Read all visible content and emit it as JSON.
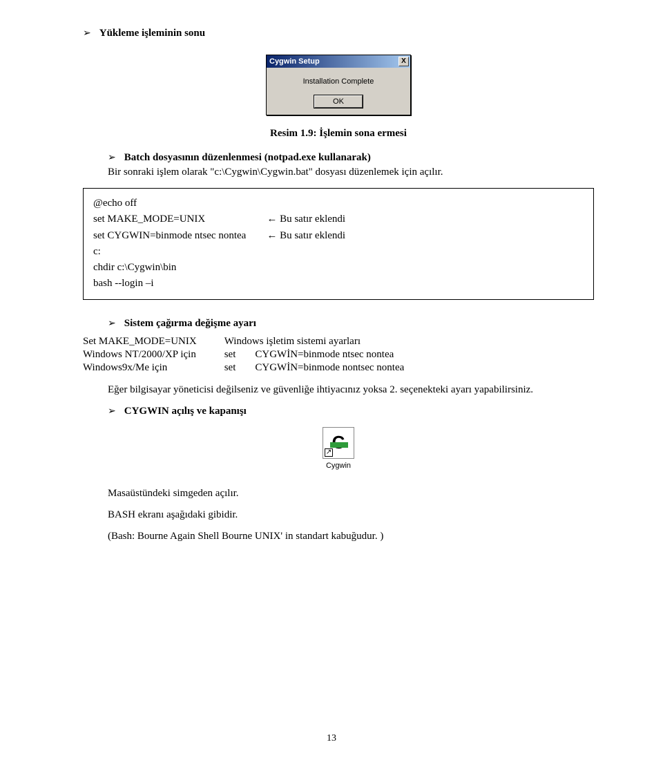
{
  "heading1": "Yükleme işleminin sonu",
  "dialog": {
    "title": "Cygwin Setup",
    "message": "Installation Complete",
    "ok": "OK",
    "close": "X"
  },
  "caption": "Resim 1.9: İşlemin sona ermesi",
  "batch_heading": "Batch dosyasının düzenlenmesi (notpad.exe kullanarak)",
  "batch_para": "Bir sonraki işlem olarak \"c:\\Cygwin\\Cygwin.bat\" dosyası düzenlemek için açılır.",
  "code": {
    "l1a": "@echo off",
    "l2a": "set MAKE_MODE=UNIX",
    "l2b": "← Bu satır eklendi",
    "l3a": "set CYGWIN=binmode ntsec nontea",
    "l3b": "← Bu satır eklendi",
    "l4a": "c:",
    "l5a": "chdir c:\\Cygwin\\bin",
    "l6a": "bash --login –i"
  },
  "sys_heading": "Sistem çağırma değişme ayarı",
  "defs": {
    "r1c1": "Set MAKE_MODE=UNIX",
    "r1c2": "Windows işletim sistemi ayarları",
    "r2c1": "Windows NT/2000/XP için",
    "r2c2_a": "set",
    "r2c2_b": "CYGWİN=binmode ntsec nontea",
    "r3c1": "Windows9x/Me için",
    "r3c2_a": "set",
    "r3c2_b": "CYGWİN=binmode nontsec nontea"
  },
  "admin_para": "Eğer bilgisayar yöneticisi değilseniz ve güvenliğe ihtiyacınız yoksa 2. seçenekteki ayarı yapabilirsiniz.",
  "open_close_heading": "CYGWIN açılış ve kapanışı",
  "icon_label": "Cygwin",
  "desktop_line": "Masaüstündeki simgeden açılır.",
  "bash_line": "BASH ekranı aşağıdaki gibidir.",
  "bash_note": "(Bash: Bourne Again Shell Bourne UNIX' in standart kabuğudur. )",
  "page_number": "13"
}
